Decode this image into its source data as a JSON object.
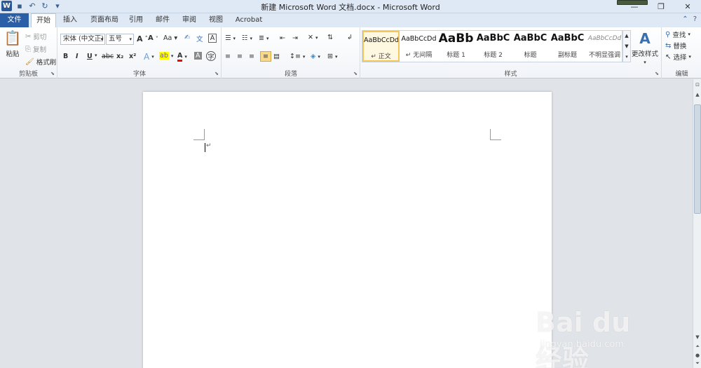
{
  "window": {
    "title": "新建 Microsoft Word 文档.docx - Microsoft Word",
    "app_icon": "W"
  },
  "quick_access": [
    {
      "icon": "save-icon",
      "glyph": "💾"
    },
    {
      "icon": "undo-icon",
      "glyph": "↶"
    },
    {
      "icon": "redo-icon",
      "glyph": "↻"
    },
    {
      "icon": "customize-icon",
      "glyph": "▾"
    }
  ],
  "tabs": [
    "文件",
    "开始",
    "插入",
    "页面布局",
    "引用",
    "邮件",
    "审阅",
    "视图",
    "Acrobat"
  ],
  "active_tab": "开始",
  "clipboard": {
    "label": "剪贴板",
    "paste": "粘贴",
    "cut": "剪切",
    "copy": "复制",
    "format_painter": "格式刷"
  },
  "font": {
    "label": "字体",
    "font_name": "宋体 (中文正)",
    "font_size": "五号",
    "bold": "B",
    "italic": "I",
    "underline": "U",
    "strikethrough": "abc",
    "subscript": "x₂",
    "superscript": "x²",
    "change_case": "Aa",
    "grow": "A",
    "shrink": "A",
    "font_color": "A"
  },
  "paragraph": {
    "label": "段落"
  },
  "styles": {
    "label": "样式",
    "items": [
      {
        "sample": "AaBbCcDd",
        "name": "↵ 正文"
      },
      {
        "sample": "AaBbCcDd",
        "name": "↵ 无间隔"
      },
      {
        "sample": "AaBb",
        "name": "标题 1"
      },
      {
        "sample": "AaBbC",
        "name": "标题 2"
      },
      {
        "sample": "AaBbC",
        "name": "标题"
      },
      {
        "sample": "AaBbC",
        "name": "副标题"
      },
      {
        "sample": "AaBbCcDd",
        "name": "不明显强调"
      }
    ],
    "change_styles": "更改样式"
  },
  "editing": {
    "label": "编辑",
    "find": "查找",
    "replace": "替换",
    "select": "选择"
  },
  "watermark": {
    "logo": "Bai du 经验",
    "url": "jingyan.baidu.com"
  },
  "colors": {
    "file_tab": "#2a5fa8",
    "selected_style": "#f3c75b",
    "highlight": "#ffff00",
    "font_color": "#ff0000"
  }
}
